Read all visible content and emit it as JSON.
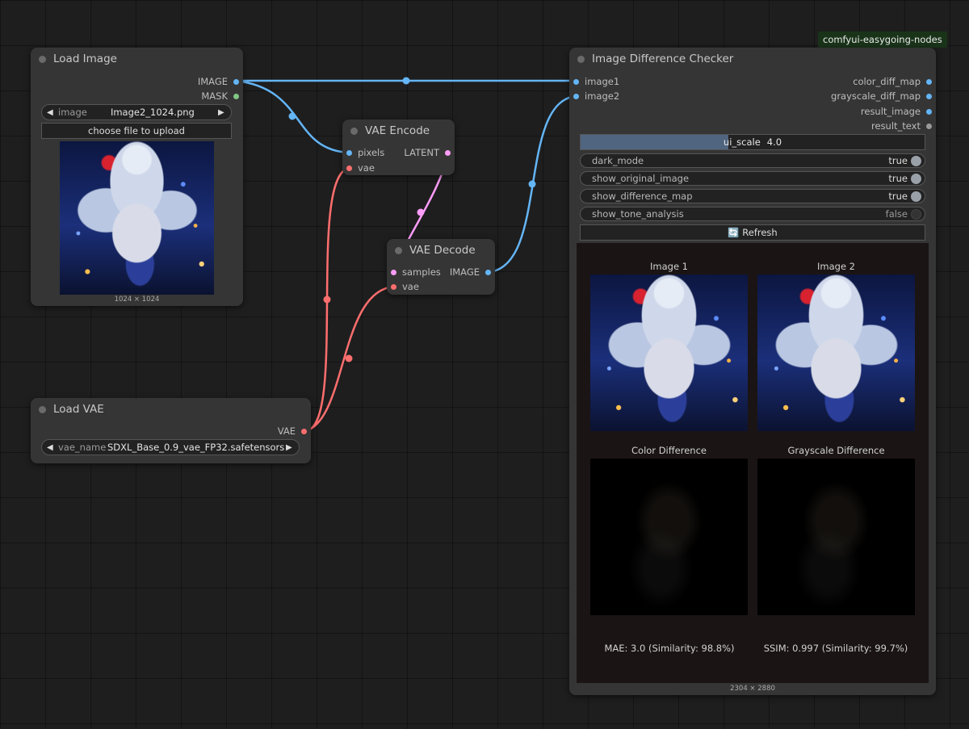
{
  "badge": "comfyui-easygoing-nodes",
  "colors": {
    "image": "#64b5f6",
    "mask": "#81c784",
    "latent": "#ff9cf9",
    "vae": "#ff6e6e",
    "string": "#999999"
  },
  "load_image": {
    "title": "Load Image",
    "outputs": [
      "IMAGE",
      "MASK"
    ],
    "combo_label": "image",
    "combo_value": "Image2_1024.png",
    "upload_button": "choose file to upload",
    "size": "1024 × 1024"
  },
  "vae_encode": {
    "title": "VAE Encode",
    "inputs": [
      "pixels",
      "vae"
    ],
    "output": "LATENT"
  },
  "vae_decode": {
    "title": "VAE Decode",
    "inputs": [
      "samples",
      "vae"
    ],
    "output": "IMAGE"
  },
  "load_vae": {
    "title": "Load VAE",
    "output": "VAE",
    "combo_label": "vae_name",
    "combo_value": "SDXL_Base_0.9_vae_FP32.safetensors"
  },
  "checker": {
    "title": "Image Difference Checker",
    "inputs": [
      "image1",
      "image2"
    ],
    "outputs": [
      "color_diff_map",
      "grayscale_diff_map",
      "result_image",
      "result_text"
    ],
    "ui_scale_label": "ui_scale",
    "ui_scale_value": "4.0",
    "ui_scale_fill": 0.43,
    "toggles": [
      {
        "name": "dark_mode",
        "value": "true"
      },
      {
        "name": "show_original_image",
        "value": "true"
      },
      {
        "name": "show_difference_map",
        "value": "true"
      },
      {
        "name": "show_tone_analysis",
        "value": "false"
      }
    ],
    "refresh": "🔄 Refresh",
    "captions": [
      "Image 1",
      "Image 2",
      "Color Difference",
      "Grayscale Difference"
    ],
    "mae": "MAE: 3.0 (Similarity: 98.8%)",
    "ssim": "SSIM: 0.997 (Similarity: 99.7%)",
    "size": "2304 × 2880"
  }
}
